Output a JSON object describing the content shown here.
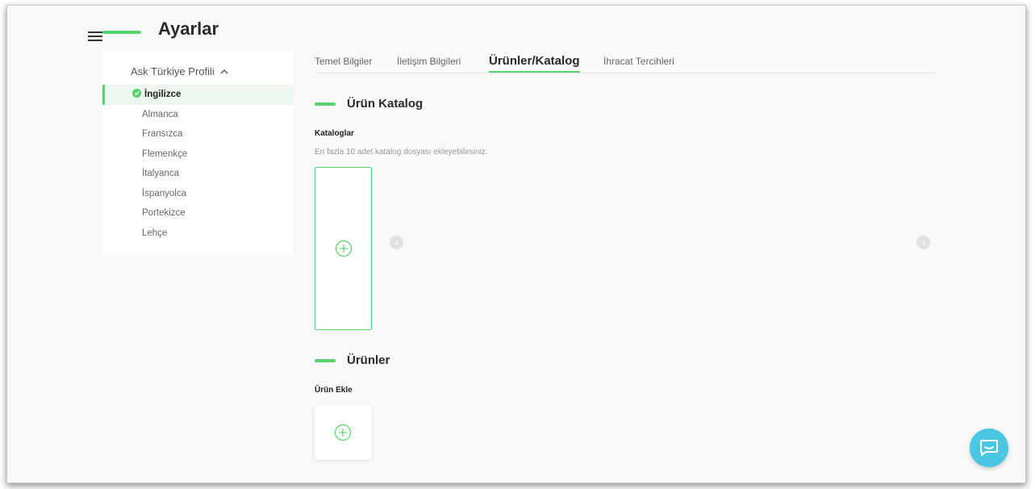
{
  "header": {
    "title": "Ayarlar"
  },
  "sidebar": {
    "profile_title": "Ask Türkiye Profili",
    "languages": [
      {
        "label": "İngilizce",
        "active": true
      },
      {
        "label": "Almanca"
      },
      {
        "label": "Fransızca"
      },
      {
        "label": "Flemenkçe"
      },
      {
        "label": "İtalyanca"
      },
      {
        "label": "İspanyolca"
      },
      {
        "label": "Portekizce"
      },
      {
        "label": "Lehçe"
      }
    ]
  },
  "tabs": [
    {
      "label": "Temel Bilgiler"
    },
    {
      "label": "İletişim Bilgileri"
    },
    {
      "label": "Ürünler/Katalog",
      "active": true
    },
    {
      "label": "İhracat Tercihleri"
    }
  ],
  "catalog": {
    "title": "Ürün Katalog",
    "sub_label": "Kataloglar",
    "hint": "En fazla 10 adet katalog dosyası ekleyebilirsiniz."
  },
  "products": {
    "title": "Ürünler",
    "sub_label": "Ürün Ekle"
  },
  "colors": {
    "accent": "#58d26b",
    "chat": "#4ac7e3"
  },
  "icons": [
    "hamburger-menu-icon",
    "chevron-up-icon",
    "check-circle-icon",
    "plus-circle-icon",
    "chevron-left-icon",
    "chevron-right-icon",
    "chat-icon"
  ]
}
